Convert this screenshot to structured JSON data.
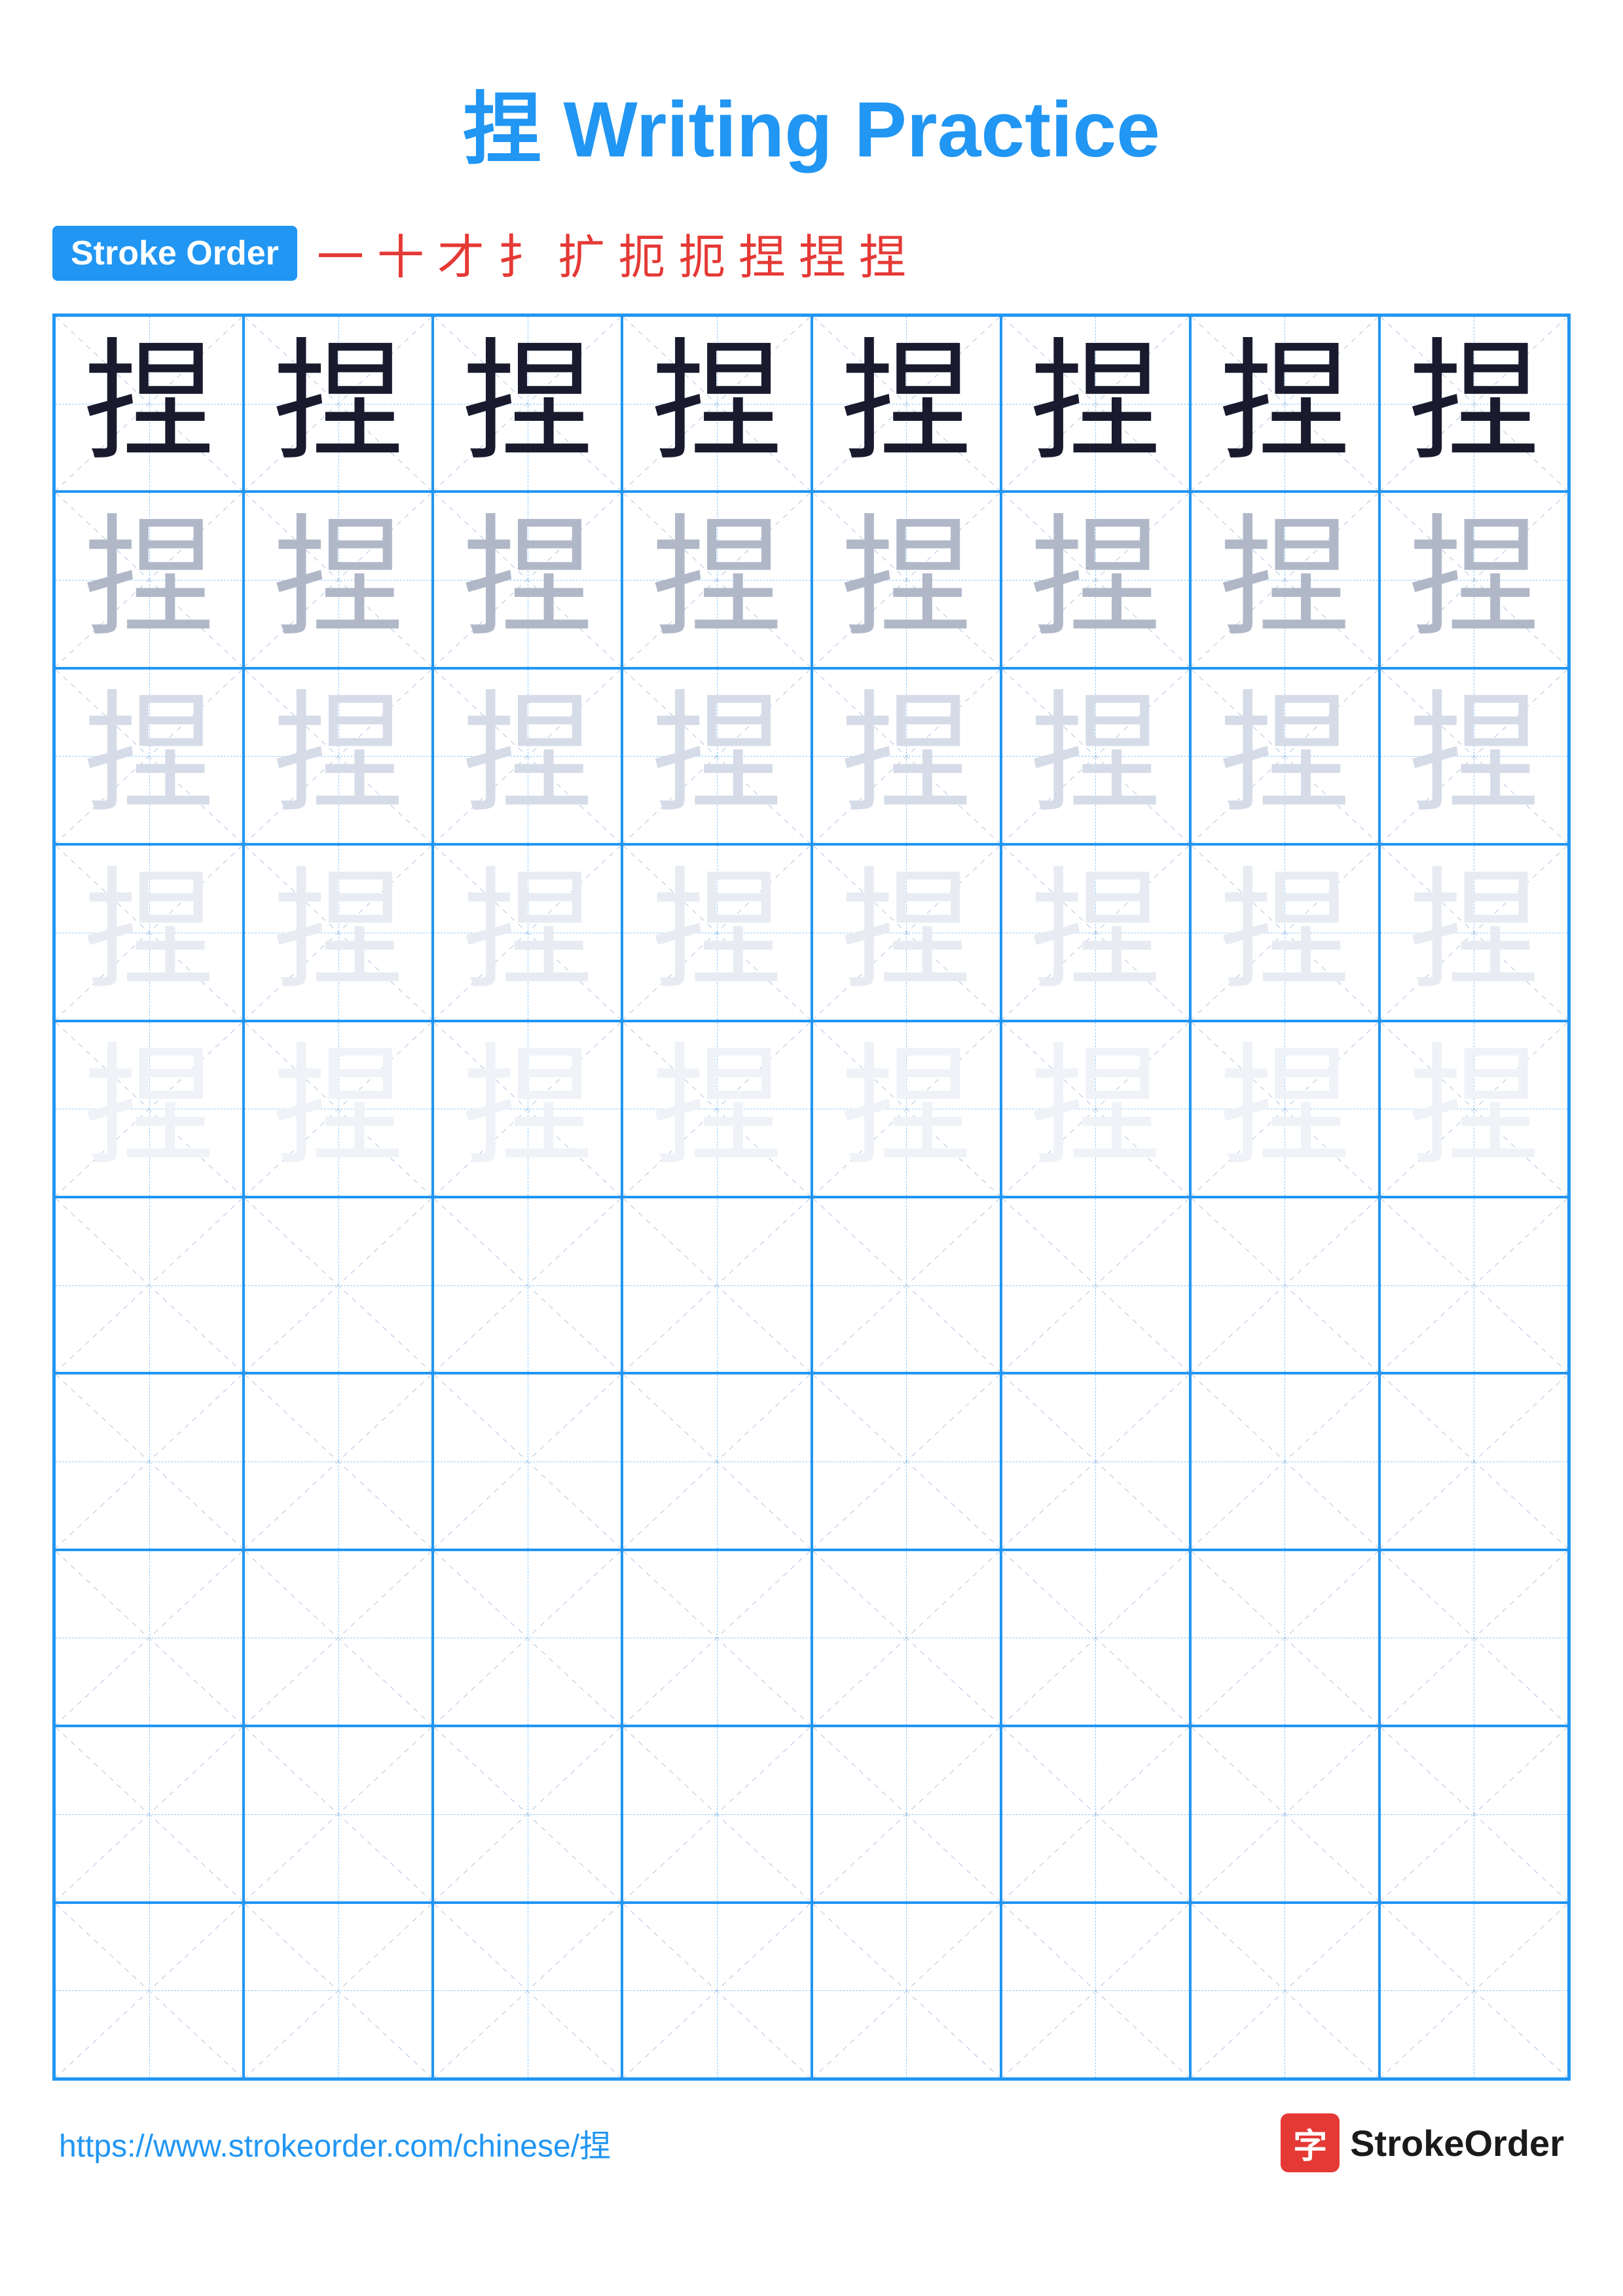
{
  "page": {
    "title": "捏 Writing Practice",
    "title_char": "捏",
    "title_rest": " Writing Practice"
  },
  "stroke_order": {
    "badge_label": "Stroke Order",
    "strokes": [
      "一",
      "十",
      "才",
      "扌",
      "扩",
      "扩",
      "扼",
      "扼",
      "捏",
      "捏"
    ]
  },
  "grid": {
    "rows": 10,
    "cols": 8,
    "char": "捏",
    "row_opacities": [
      "dark",
      "medium",
      "light",
      "very-light",
      "faint",
      "empty",
      "empty",
      "empty",
      "empty",
      "empty"
    ]
  },
  "footer": {
    "url": "https://www.strokeorder.com/chinese/捏",
    "brand": "StrokeOrder",
    "brand_char": "字"
  }
}
